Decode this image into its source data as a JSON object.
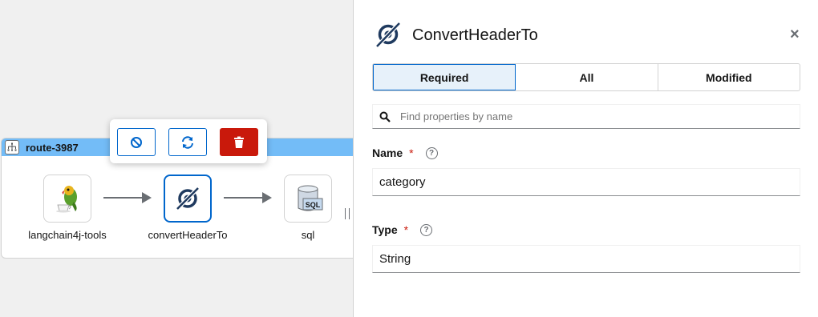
{
  "canvas": {
    "route": {
      "name": "route-3987"
    },
    "nodes": [
      {
        "label": "langchain4j-tools",
        "icon": "parrot-teacup-icon"
      },
      {
        "label": "convertHeaderTo",
        "icon": "convert-header-icon",
        "selected": true
      },
      {
        "label": "sql",
        "icon": "sql-database-icon"
      }
    ],
    "toolbar": {
      "disable_icon": "disable-icon",
      "replace_icon": "replace-icon",
      "delete_icon": "trash-icon"
    }
  },
  "panel": {
    "title": "ConvertHeaderTo",
    "close": "×",
    "tabs": [
      "Required",
      "All",
      "Modified"
    ],
    "active_tab": "Required",
    "search": {
      "placeholder": "Find properties by name"
    },
    "fields": [
      {
        "label": "Name",
        "required": "*",
        "help": "?",
        "value": "category"
      },
      {
        "label": "Type",
        "required": "*",
        "help": "?",
        "value": "String"
      }
    ]
  },
  "colors": {
    "accent": "#0066cc",
    "route_header": "#73bcf7",
    "danger": "#c9190b",
    "active_tab_bg": "#e7f1fa"
  }
}
